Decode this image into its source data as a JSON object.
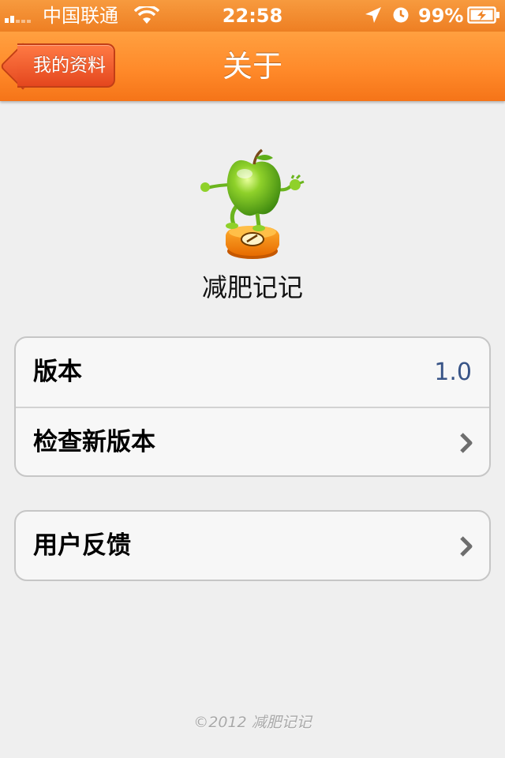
{
  "status_bar": {
    "carrier": "中国联通",
    "time": "22:58",
    "battery": "99%",
    "icons": [
      "signal-bars-icon",
      "wifi-icon",
      "location-arrow-icon",
      "alarm-clock-icon",
      "battery-charging-icon"
    ]
  },
  "nav": {
    "back_label": "我的资料",
    "title": "关于"
  },
  "app": {
    "name": "减肥记记",
    "logo_icon": "apple-on-scale-icon"
  },
  "settings": {
    "group1": [
      {
        "label": "版本",
        "value": "1.0"
      },
      {
        "label": "检查新版本",
        "accessory": "chevron-right-icon"
      }
    ],
    "group2": [
      {
        "label": "用户反馈",
        "accessory": "chevron-right-icon"
      }
    ]
  },
  "footer": {
    "copyright": "©2012 减肥记记"
  },
  "colors": {
    "nav_orange": "#ff8a2a",
    "back_button_red": "#e4471e",
    "value_blue": "#385487",
    "background": "#efefef"
  }
}
